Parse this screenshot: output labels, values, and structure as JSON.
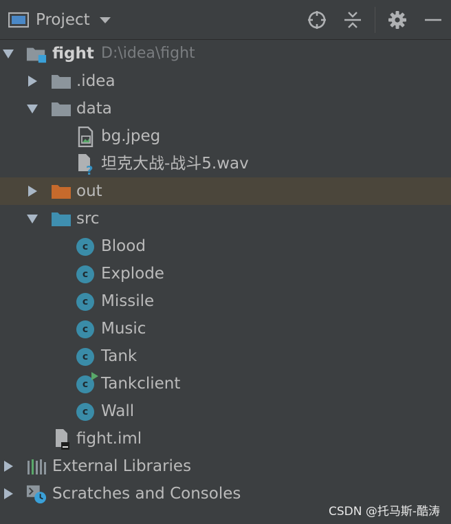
{
  "header": {
    "title": "Project",
    "actions": [
      {
        "name": "locate-icon",
        "label": "Locate"
      },
      {
        "name": "collapse-all-icon",
        "label": "Collapse All"
      },
      {
        "name": "gear-icon",
        "label": "Settings"
      },
      {
        "name": "minimize-icon",
        "label": "Hide"
      }
    ]
  },
  "tree": {
    "root": {
      "label": "fight",
      "path": "D:\\idea\\fight"
    },
    "idea": {
      "label": ".idea"
    },
    "data": {
      "label": "data"
    },
    "bg_file": {
      "label": "bg.jpeg"
    },
    "wav_file": {
      "label": "坦克大战-战斗5.wav"
    },
    "out": {
      "label": "out"
    },
    "src": {
      "label": "src"
    },
    "classes": [
      {
        "label": "Blood",
        "icon": "class-icon"
      },
      {
        "label": "Explode",
        "icon": "class-icon"
      },
      {
        "label": "Missile",
        "icon": "class-icon"
      },
      {
        "label": "Music",
        "icon": "class-icon"
      },
      {
        "label": "Tank",
        "icon": "class-icon"
      },
      {
        "label": "Tankclient",
        "icon": "runnable-class-icon"
      },
      {
        "label": "Wall",
        "icon": "class-icon"
      }
    ],
    "iml": {
      "label": "fight.iml"
    },
    "external_libraries": {
      "label": "External Libraries"
    },
    "scratches": {
      "label": "Scratches and Consoles"
    }
  },
  "watermark": "CSDN @托马斯-酷涛",
  "colors": {
    "background": "#3c3f41",
    "selected_row": "#4b463b",
    "folder_gray": "#8c959c",
    "folder_orange": "#c66a2c",
    "folder_blue": "#3f8fb0",
    "class_icon": "#3a8ca8",
    "run_green": "#59a869"
  }
}
